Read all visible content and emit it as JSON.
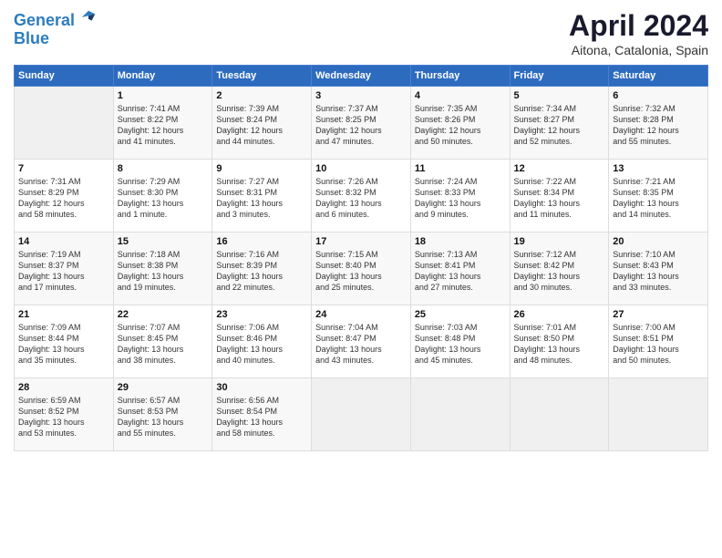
{
  "header": {
    "logo_line1": "General",
    "logo_line2": "Blue",
    "month_title": "April 2024",
    "subtitle": "Aitona, Catalonia, Spain"
  },
  "days_of_week": [
    "Sunday",
    "Monday",
    "Tuesday",
    "Wednesday",
    "Thursday",
    "Friday",
    "Saturday"
  ],
  "weeks": [
    [
      {
        "day": "",
        "info": ""
      },
      {
        "day": "1",
        "info": "Sunrise: 7:41 AM\nSunset: 8:22 PM\nDaylight: 12 hours\nand 41 minutes."
      },
      {
        "day": "2",
        "info": "Sunrise: 7:39 AM\nSunset: 8:24 PM\nDaylight: 12 hours\nand 44 minutes."
      },
      {
        "day": "3",
        "info": "Sunrise: 7:37 AM\nSunset: 8:25 PM\nDaylight: 12 hours\nand 47 minutes."
      },
      {
        "day": "4",
        "info": "Sunrise: 7:35 AM\nSunset: 8:26 PM\nDaylight: 12 hours\nand 50 minutes."
      },
      {
        "day": "5",
        "info": "Sunrise: 7:34 AM\nSunset: 8:27 PM\nDaylight: 12 hours\nand 52 minutes."
      },
      {
        "day": "6",
        "info": "Sunrise: 7:32 AM\nSunset: 8:28 PM\nDaylight: 12 hours\nand 55 minutes."
      }
    ],
    [
      {
        "day": "7",
        "info": "Sunrise: 7:31 AM\nSunset: 8:29 PM\nDaylight: 12 hours\nand 58 minutes."
      },
      {
        "day": "8",
        "info": "Sunrise: 7:29 AM\nSunset: 8:30 PM\nDaylight: 13 hours\nand 1 minute."
      },
      {
        "day": "9",
        "info": "Sunrise: 7:27 AM\nSunset: 8:31 PM\nDaylight: 13 hours\nand 3 minutes."
      },
      {
        "day": "10",
        "info": "Sunrise: 7:26 AM\nSunset: 8:32 PM\nDaylight: 13 hours\nand 6 minutes."
      },
      {
        "day": "11",
        "info": "Sunrise: 7:24 AM\nSunset: 8:33 PM\nDaylight: 13 hours\nand 9 minutes."
      },
      {
        "day": "12",
        "info": "Sunrise: 7:22 AM\nSunset: 8:34 PM\nDaylight: 13 hours\nand 11 minutes."
      },
      {
        "day": "13",
        "info": "Sunrise: 7:21 AM\nSunset: 8:35 PM\nDaylight: 13 hours\nand 14 minutes."
      }
    ],
    [
      {
        "day": "14",
        "info": "Sunrise: 7:19 AM\nSunset: 8:37 PM\nDaylight: 13 hours\nand 17 minutes."
      },
      {
        "day": "15",
        "info": "Sunrise: 7:18 AM\nSunset: 8:38 PM\nDaylight: 13 hours\nand 19 minutes."
      },
      {
        "day": "16",
        "info": "Sunrise: 7:16 AM\nSunset: 8:39 PM\nDaylight: 13 hours\nand 22 minutes."
      },
      {
        "day": "17",
        "info": "Sunrise: 7:15 AM\nSunset: 8:40 PM\nDaylight: 13 hours\nand 25 minutes."
      },
      {
        "day": "18",
        "info": "Sunrise: 7:13 AM\nSunset: 8:41 PM\nDaylight: 13 hours\nand 27 minutes."
      },
      {
        "day": "19",
        "info": "Sunrise: 7:12 AM\nSunset: 8:42 PM\nDaylight: 13 hours\nand 30 minutes."
      },
      {
        "day": "20",
        "info": "Sunrise: 7:10 AM\nSunset: 8:43 PM\nDaylight: 13 hours\nand 33 minutes."
      }
    ],
    [
      {
        "day": "21",
        "info": "Sunrise: 7:09 AM\nSunset: 8:44 PM\nDaylight: 13 hours\nand 35 minutes."
      },
      {
        "day": "22",
        "info": "Sunrise: 7:07 AM\nSunset: 8:45 PM\nDaylight: 13 hours\nand 38 minutes."
      },
      {
        "day": "23",
        "info": "Sunrise: 7:06 AM\nSunset: 8:46 PM\nDaylight: 13 hours\nand 40 minutes."
      },
      {
        "day": "24",
        "info": "Sunrise: 7:04 AM\nSunset: 8:47 PM\nDaylight: 13 hours\nand 43 minutes."
      },
      {
        "day": "25",
        "info": "Sunrise: 7:03 AM\nSunset: 8:48 PM\nDaylight: 13 hours\nand 45 minutes."
      },
      {
        "day": "26",
        "info": "Sunrise: 7:01 AM\nSunset: 8:50 PM\nDaylight: 13 hours\nand 48 minutes."
      },
      {
        "day": "27",
        "info": "Sunrise: 7:00 AM\nSunset: 8:51 PM\nDaylight: 13 hours\nand 50 minutes."
      }
    ],
    [
      {
        "day": "28",
        "info": "Sunrise: 6:59 AM\nSunset: 8:52 PM\nDaylight: 13 hours\nand 53 minutes."
      },
      {
        "day": "29",
        "info": "Sunrise: 6:57 AM\nSunset: 8:53 PM\nDaylight: 13 hours\nand 55 minutes."
      },
      {
        "day": "30",
        "info": "Sunrise: 6:56 AM\nSunset: 8:54 PM\nDaylight: 13 hours\nand 58 minutes."
      },
      {
        "day": "",
        "info": ""
      },
      {
        "day": "",
        "info": ""
      },
      {
        "day": "",
        "info": ""
      },
      {
        "day": "",
        "info": ""
      }
    ]
  ]
}
